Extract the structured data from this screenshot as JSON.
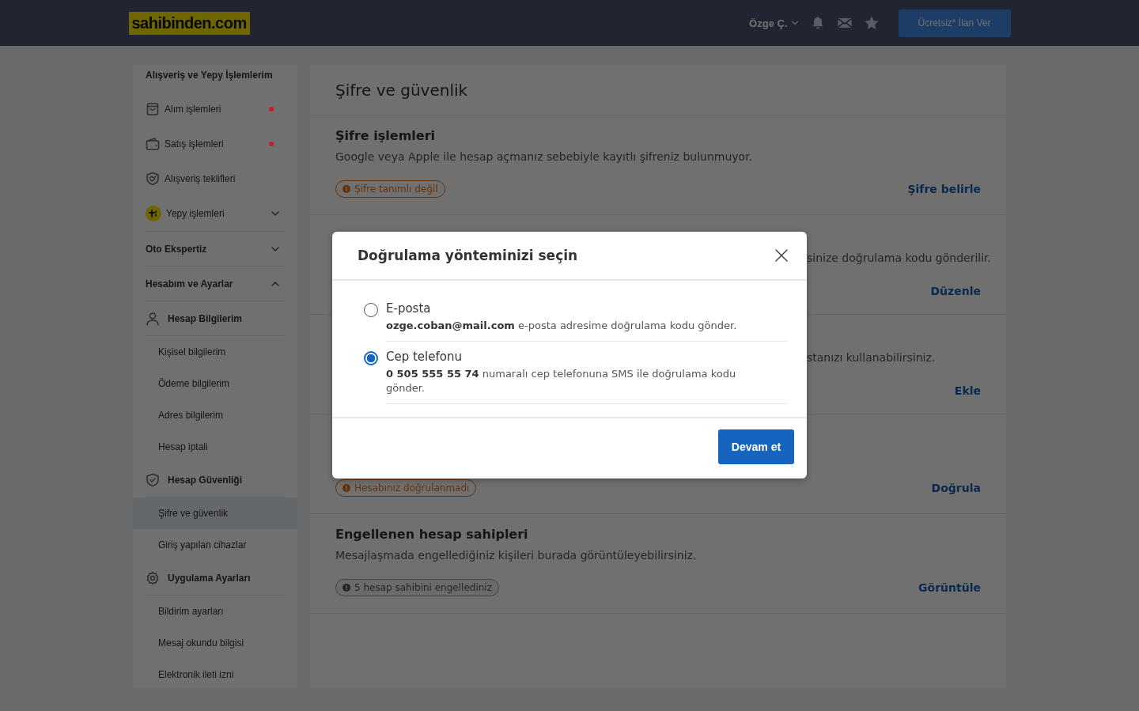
{
  "header": {
    "logo": "sahibinden.com",
    "user": "Özge Ç.",
    "post_button": "Ücretsiz* İlan Ver"
  },
  "sidebar": {
    "items": [
      {
        "kind": "section",
        "label": "Alışveriş ve Yepy İşlemlerim"
      },
      {
        "kind": "item",
        "label": "Alım işlemleri",
        "color": "#c81e2a"
      },
      {
        "kind": "item",
        "label": "Satış işlemleri",
        "color": "#c81e2a"
      },
      {
        "kind": "item",
        "label": "Alışveriş teklifleri"
      },
      {
        "kind": "item",
        "label": "Yepy işlemleri",
        "expanded": false
      },
      {
        "kind": "section",
        "label": "Oto Ekspertiz",
        "expanded": false
      },
      {
        "kind": "section",
        "label": "Hesabım ve Ayarlar",
        "expanded": true
      },
      {
        "kind": "group",
        "label": "Hesap Bilgilerim"
      },
      {
        "kind": "sub",
        "label": "Kişisel bilgilerim",
        "selected": false
      },
      {
        "kind": "sub",
        "label": "Ödeme bilgilerim",
        "selected": false
      },
      {
        "kind": "sub",
        "label": "Adres bilgilerim",
        "selected": false
      },
      {
        "kind": "sub",
        "label": "Hesap iptali",
        "selected": false
      },
      {
        "kind": "group",
        "label": "Hesap Güvenliği"
      },
      {
        "kind": "sub",
        "label": "Şifre ve güvenlik",
        "selected": true
      },
      {
        "kind": "sub",
        "label": "Giriş yapılan cihazlar",
        "selected": false
      },
      {
        "kind": "group",
        "label": "Uygulama Ayarları"
      },
      {
        "kind": "sub",
        "label": "Bildirim ayarları",
        "selected": false
      },
      {
        "kind": "sub",
        "label": "Mesaj okundu bilgisi",
        "selected": false
      },
      {
        "kind": "sub",
        "label": "Elektronik ileti izni",
        "selected": false
      }
    ]
  },
  "main": {
    "title": "Şifre ve güvenlik",
    "sections": [
      {
        "kind": "full",
        "title": "Şifre işlemleri",
        "description": "Google veya Apple ile hesap açmanız sebebiyle kayıtlı şifreniz bulunmuyor.",
        "tag": {
          "kind": "warning",
          "text": "Şifre tanımlı değil"
        },
        "action": "Şifre belirle"
      },
      {
        "kind": "partial",
        "description": "sinize doğrulama kodu gönderilir.",
        "action": "Düzenle"
      },
      {
        "kind": "partial",
        "description": "stanızı kullanabilirsiniz.",
        "action": "Ekle"
      },
      {
        "kind": "hidden",
        "tag": {
          "kind": "warning",
          "text": "Hesabınız doğrulanmadı"
        },
        "action": "Doğrula"
      },
      {
        "kind": "full",
        "title": "Engellenen hesap sahipleri",
        "description": "Mesajlaşmada engellediğiniz kişileri burada görüntüleyebilirsiniz.",
        "tag": {
          "kind": "info",
          "text": "5 hesap sahibini engellediniz"
        },
        "action": "Görüntüle"
      }
    ]
  },
  "modal": {
    "title": "Doğrulama yönteminizi seçin",
    "options": [
      {
        "label": "E-posta",
        "description": "**ozge.coban@mail.com** e-posta adresime doğrulama kodu gönder.",
        "selected": false
      },
      {
        "label": "Cep telefonu",
        "description": "**0 505 555 55 74** numaralı cep telefonuna SMS ile doğrulama kodu gönder.",
        "selected": true
      }
    ],
    "button": "Devam et"
  }
}
